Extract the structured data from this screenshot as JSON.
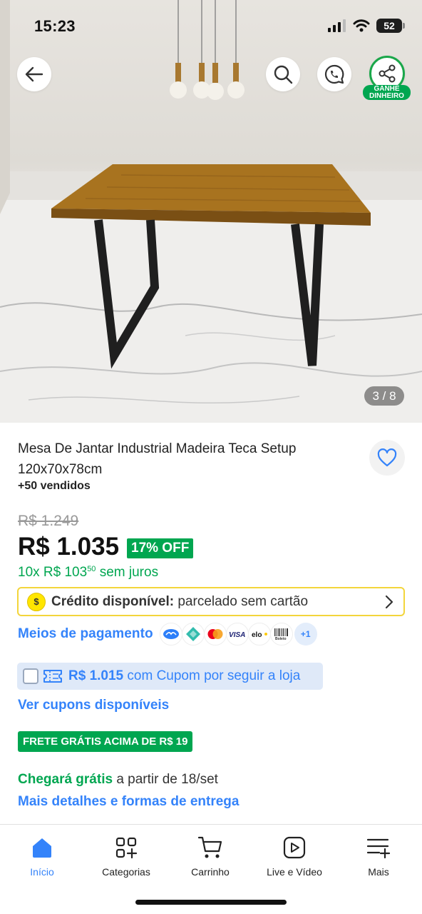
{
  "status_bar": {
    "time": "15:23",
    "battery": "52"
  },
  "image_viewer": {
    "counter": "3 / 8"
  },
  "header": {
    "earn_badge_line1": "GANHE",
    "earn_badge_line2": "DINHEIRO"
  },
  "product": {
    "title": "Mesa De Jantar Industrial Madeira Teca Setup 120x70x78cm",
    "sold": "+50 vendidos",
    "old_price": "R$ 1.249",
    "price": "R$ 1.035",
    "discount": "17% OFF",
    "installments_prefix": "10x R$ 103",
    "installments_cents": "50",
    "installments_suffix": "sem juros"
  },
  "credit": {
    "coin": "$",
    "label": "Crédito disponível:",
    "text": "parcelado sem cartão"
  },
  "payment": {
    "label": "Meios de pagamento",
    "methods": [
      "Mercado Pago",
      "Pix",
      "Mastercard",
      "VISA",
      "elo",
      "Boleto"
    ],
    "more": "+1"
  },
  "coupon": {
    "price": "R$ 1.015",
    "text": "com Cupom por seguir a loja",
    "see_all": "Ver cupons disponíveis"
  },
  "shipping": {
    "badge": "FRETE GRÁTIS ACIMA DE R$ 19",
    "arrival_bold": "Chegará grátis",
    "arrival_rest": "a partir de 18/set",
    "details_link": "Mais detalhes e formas de entrega"
  },
  "bottom_nav": [
    {
      "label": "Início",
      "icon": "home-icon",
      "active": true
    },
    {
      "label": "Categorias",
      "icon": "categories-icon"
    },
    {
      "label": "Carrinho",
      "icon": "cart-icon"
    },
    {
      "label": "Live e Vídeo",
      "icon": "play-icon"
    },
    {
      "label": "Mais",
      "icon": "menu-plus-icon"
    }
  ],
  "colors": {
    "brand_blue": "#3483fa",
    "green": "#00a650",
    "credit_border": "#f3d53b"
  }
}
